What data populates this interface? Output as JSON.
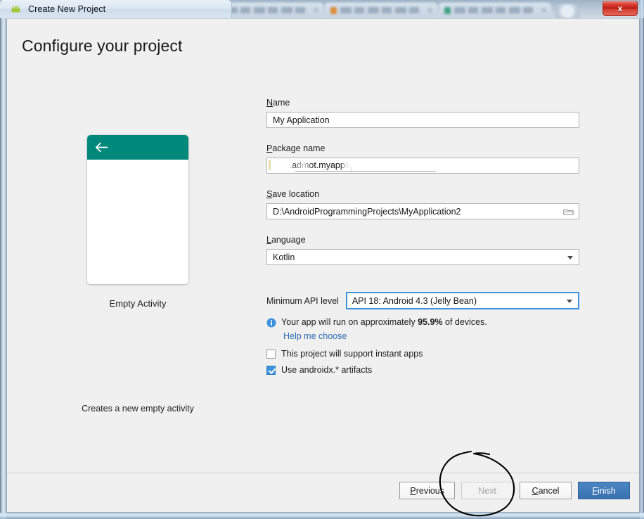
{
  "window": {
    "title": "Create New Project",
    "title_icon": "android-robot-icon",
    "close_label": "x"
  },
  "background_tabs": [
    {
      "favicon_color": "#c0392b"
    },
    {
      "favicon_color": "#1e8a6e"
    },
    {
      "favicon_color": "#e08a2e"
    },
    {
      "favicon_color": "#3aa17e"
    }
  ],
  "page": {
    "title": "Configure your project"
  },
  "preview": {
    "template_label": "Empty Activity",
    "description": "Creates a new empty activity",
    "appbar_color": "#00897b",
    "back_icon": "back-arrow-icon"
  },
  "form": {
    "name": {
      "label": "Name",
      "mnemonic": "N",
      "label_rest": "ame",
      "value": "My Application"
    },
    "package": {
      "label": "Package name",
      "mnemonic": "P",
      "label_rest": "ackage name",
      "value": "com.admot.myapplication",
      "value_second": "application"
    },
    "save_location": {
      "label": "Save location",
      "mnemonic": "S",
      "label_rest": "ave location",
      "value": "D:\\AndroidProgrammingProjects\\MyApplication2",
      "browse_icon": "folder-icon"
    },
    "language": {
      "label": "Language",
      "mnemonic": "L",
      "label_rest": "anguage",
      "value": "Kotlin"
    },
    "min_api": {
      "label": "Minimum API level",
      "value": "API 18: Android 4.3 (Jelly Bean)"
    },
    "device_info": {
      "icon": "info-icon",
      "prefix": "Your app will run on approximately ",
      "percent": "95.9%",
      "suffix": " of devices.",
      "help_link": "Help me choose"
    },
    "instant_apps": {
      "label": "This project will support instant apps",
      "checked": false
    },
    "androidx": {
      "label": "Use androidx.* artifacts",
      "checked": true
    }
  },
  "footer": {
    "buttons": [
      {
        "label": "Previous",
        "mnemonic": "P",
        "rest": "revious",
        "style": "normal",
        "disabled": false
      },
      {
        "label": "Next",
        "mnemonic": "",
        "rest": "Next",
        "style": "normal",
        "disabled": true
      },
      {
        "label": "Cancel",
        "mnemonic": "C",
        "rest": "ancel",
        "style": "normal",
        "disabled": false
      },
      {
        "label": "Finish",
        "mnemonic": "F",
        "rest": "inish",
        "style": "primary",
        "disabled": false
      }
    ]
  },
  "annotation": {
    "shape": "hand-drawn-circle",
    "target": "Next",
    "color": "#000000"
  },
  "colors": {
    "accent": "#3c92dd",
    "primary_button": "#3b72b0",
    "teal": "#00897b",
    "link": "#2f6db5",
    "dialog_bg": "#f0f0f0"
  }
}
